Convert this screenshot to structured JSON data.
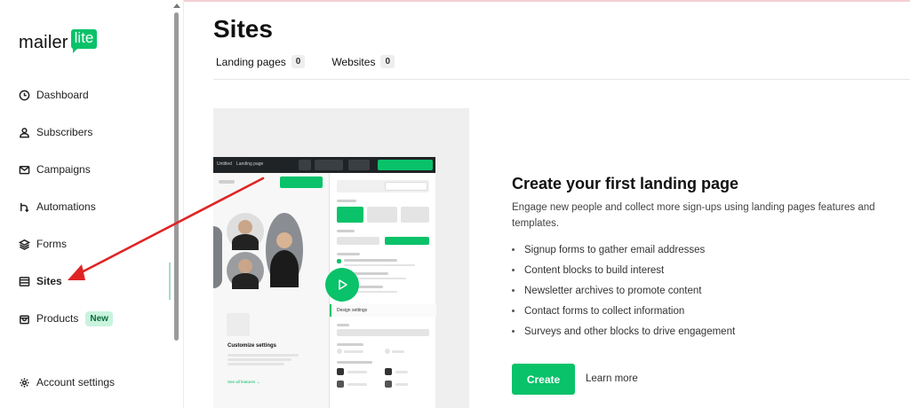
{
  "app": {
    "logo_text": "mailer",
    "logo_badge": "lite"
  },
  "sidebar": {
    "items": [
      {
        "label": "Dashboard",
        "icon": "clock-icon"
      },
      {
        "label": "Subscribers",
        "icon": "person-icon"
      },
      {
        "label": "Campaigns",
        "icon": "envelope-icon"
      },
      {
        "label": "Automations",
        "icon": "workflow-icon"
      },
      {
        "label": "Forms",
        "icon": "layers-icon"
      },
      {
        "label": "Sites",
        "icon": "browser-icon",
        "active": true
      },
      {
        "label": "Products",
        "icon": "bag-icon",
        "badge": "New"
      }
    ],
    "account_settings": "Account settings"
  },
  "page": {
    "title": "Sites",
    "tabs": [
      {
        "label": "Landing pages",
        "count": "0"
      },
      {
        "label": "Websites",
        "count": "0"
      }
    ]
  },
  "empty_state": {
    "title": "Create your first landing page",
    "description": "Engage new people and collect more sign-ups using landing pages features and templates.",
    "features": [
      "Signup forms to gather email addresses",
      "Content blocks to build interest",
      "Newsletter archives to promote content",
      "Contact forms to collect information",
      "Surveys and other blocks to drive engagement"
    ],
    "create_label": "Create",
    "learn_more_label": "Learn more"
  },
  "preview": {
    "customize_title": "Customize settings",
    "design_settings": "Design settings",
    "see_all": "See all features →"
  },
  "colors": {
    "brand": "#09c269",
    "annotation_arrow": "#e02424"
  }
}
